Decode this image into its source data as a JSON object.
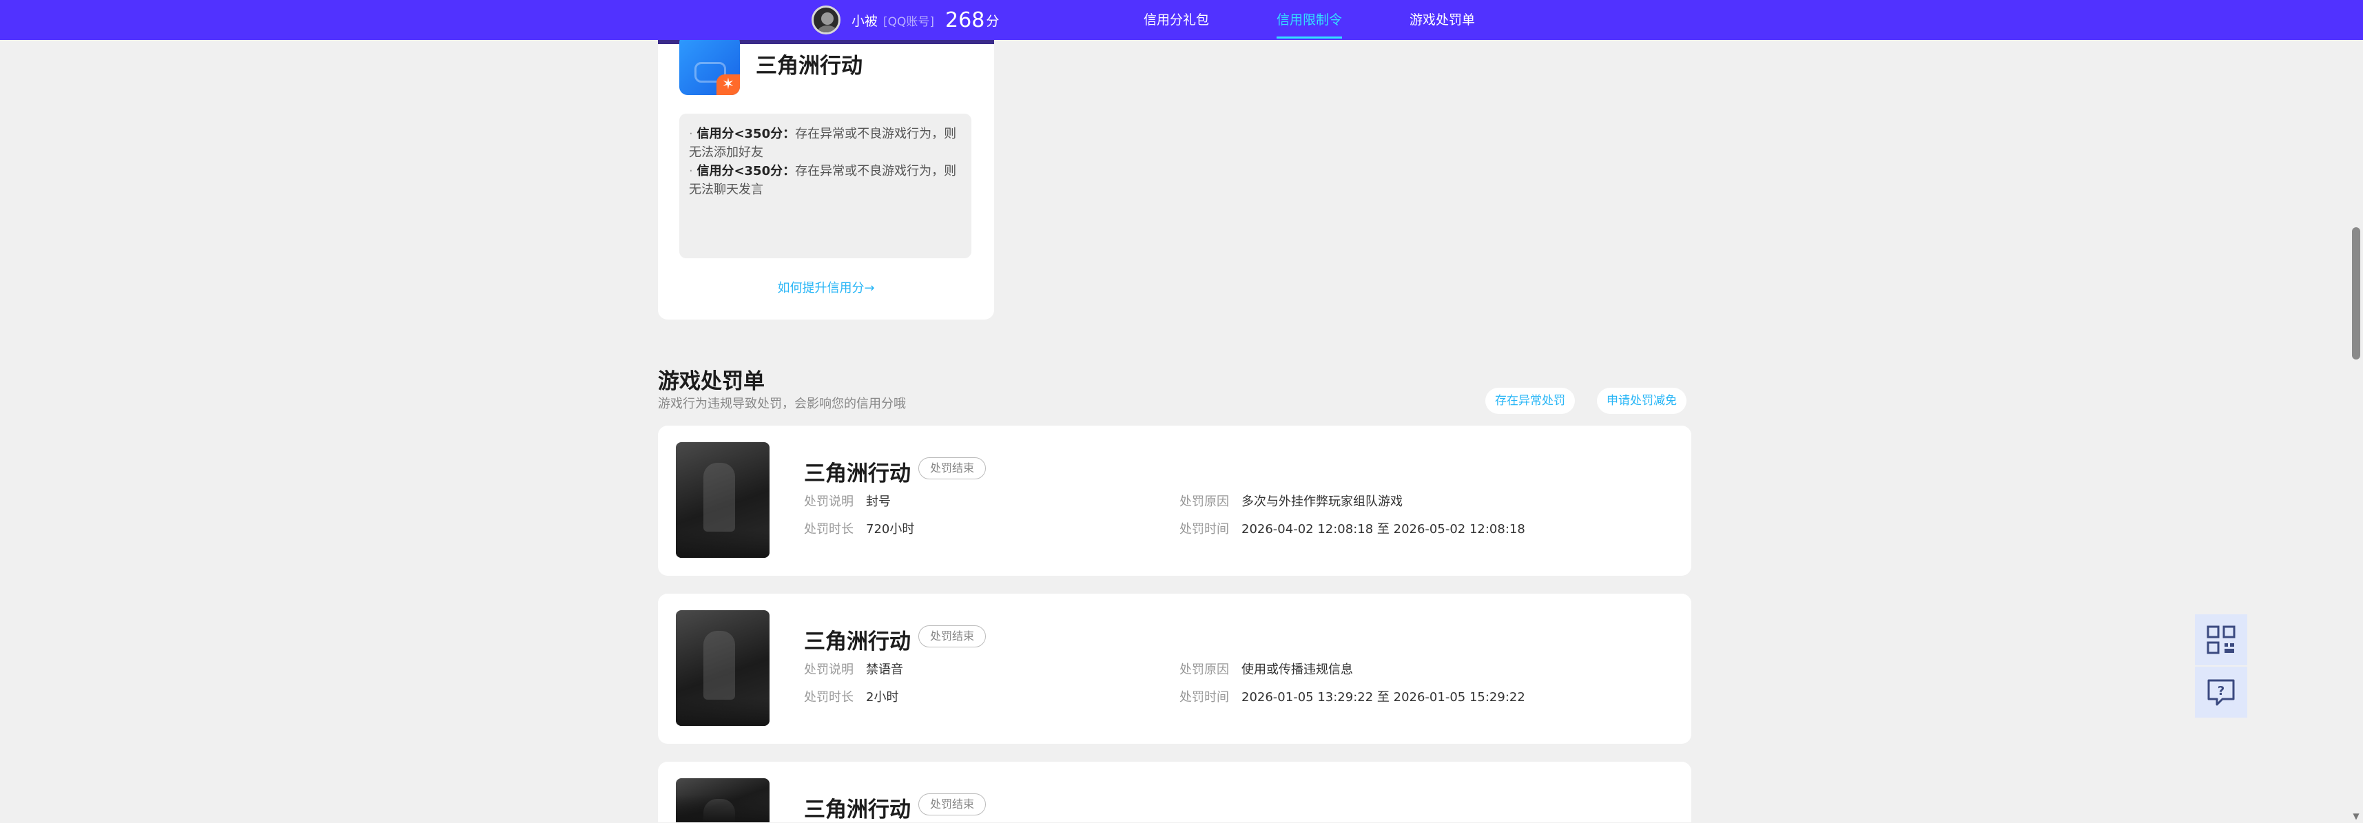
{
  "header": {
    "username": "小被",
    "account_type": "[QQ账号]",
    "score": "268",
    "score_unit": "分",
    "nav": [
      {
        "label": "信用分礼包",
        "active": false
      },
      {
        "label": "信用限制令",
        "active": true
      },
      {
        "label": "游戏处罚单",
        "active": false
      }
    ]
  },
  "credit_card": {
    "game_name": "三角洲行动",
    "rules": [
      {
        "bold": "信用分<350分：",
        "text": "存在异常或不良游戏行为，则无法添加好友"
      },
      {
        "bold": "信用分<350分：",
        "text": "存在异常或不良游戏行为，则无法聊天发言"
      }
    ],
    "improve_link": "如何提升信用分→"
  },
  "penalty_section": {
    "title": "游戏处罚单",
    "subtitle": "游戏行为违规导致处罚，会影响您的信用分哦",
    "buttons": [
      "存在异常处罚",
      "申请处罚减免"
    ]
  },
  "records": [
    {
      "game_name": "三角洲行动",
      "status": "处罚结束",
      "desc_label": "处罚说明",
      "desc_value": "封号",
      "duration_label": "处罚时长",
      "duration_value": "720小时",
      "reason_label": "处罚原因",
      "reason_value": "多次与外挂作弊玩家组队游戏",
      "time_label": "处罚时间",
      "time_value": "2026-04-02 12:08:18 至 2026-05-02 12:08:18"
    },
    {
      "game_name": "三角洲行动",
      "status": "处罚结束",
      "desc_label": "处罚说明",
      "desc_value": "禁语音",
      "duration_label": "处罚时长",
      "duration_value": "2小时",
      "reason_label": "处罚原因",
      "reason_value": "使用或传播违规信息",
      "time_label": "处罚时间",
      "time_value": "2026-01-05 13:29:22 至 2026-01-05 15:29:22"
    },
    {
      "game_name": "三角洲行动",
      "status": "处罚结束"
    }
  ],
  "float_buttons": [
    {
      "icon": "qrcode-icon"
    },
    {
      "icon": "help-chat-icon"
    }
  ],
  "colors": {
    "topbar": "#5132ff",
    "accent": "#33e0ff",
    "link": "#29b6f6",
    "background": "#f0f0f0"
  }
}
